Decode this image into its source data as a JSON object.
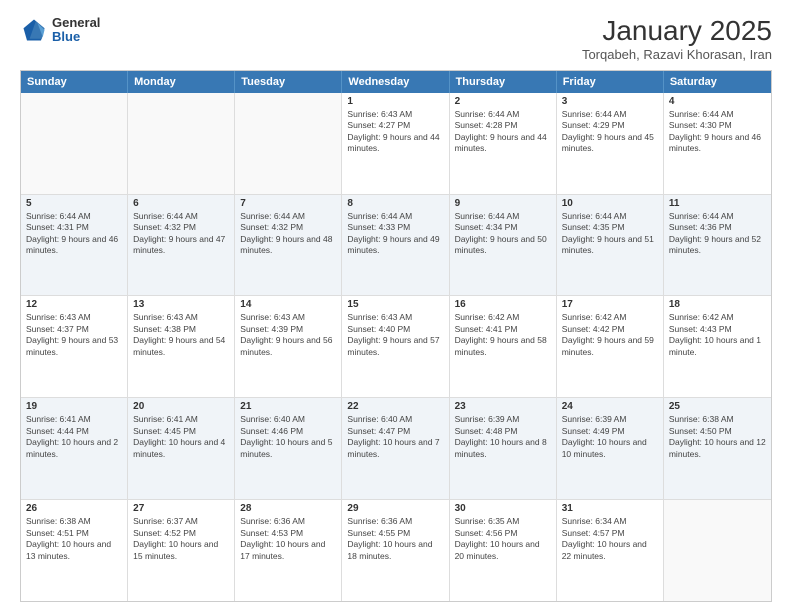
{
  "header": {
    "logo": {
      "general": "General",
      "blue": "Blue"
    },
    "title": "January 2025",
    "subtitle": "Torqabeh, Razavi Khorasan, Iran"
  },
  "calendar": {
    "days": [
      "Sunday",
      "Monday",
      "Tuesday",
      "Wednesday",
      "Thursday",
      "Friday",
      "Saturday"
    ],
    "rows": [
      [
        {
          "day": "",
          "empty": true
        },
        {
          "day": "",
          "empty": true
        },
        {
          "day": "",
          "empty": true
        },
        {
          "day": "1",
          "sunrise": "Sunrise: 6:43 AM",
          "sunset": "Sunset: 4:27 PM",
          "daylight": "Daylight: 9 hours and 44 minutes."
        },
        {
          "day": "2",
          "sunrise": "Sunrise: 6:44 AM",
          "sunset": "Sunset: 4:28 PM",
          "daylight": "Daylight: 9 hours and 44 minutes."
        },
        {
          "day": "3",
          "sunrise": "Sunrise: 6:44 AM",
          "sunset": "Sunset: 4:29 PM",
          "daylight": "Daylight: 9 hours and 45 minutes."
        },
        {
          "day": "4",
          "sunrise": "Sunrise: 6:44 AM",
          "sunset": "Sunset: 4:30 PM",
          "daylight": "Daylight: 9 hours and 46 minutes."
        }
      ],
      [
        {
          "day": "5",
          "sunrise": "Sunrise: 6:44 AM",
          "sunset": "Sunset: 4:31 PM",
          "daylight": "Daylight: 9 hours and 46 minutes."
        },
        {
          "day": "6",
          "sunrise": "Sunrise: 6:44 AM",
          "sunset": "Sunset: 4:32 PM",
          "daylight": "Daylight: 9 hours and 47 minutes."
        },
        {
          "day": "7",
          "sunrise": "Sunrise: 6:44 AM",
          "sunset": "Sunset: 4:32 PM",
          "daylight": "Daylight: 9 hours and 48 minutes."
        },
        {
          "day": "8",
          "sunrise": "Sunrise: 6:44 AM",
          "sunset": "Sunset: 4:33 PM",
          "daylight": "Daylight: 9 hours and 49 minutes."
        },
        {
          "day": "9",
          "sunrise": "Sunrise: 6:44 AM",
          "sunset": "Sunset: 4:34 PM",
          "daylight": "Daylight: 9 hours and 50 minutes."
        },
        {
          "day": "10",
          "sunrise": "Sunrise: 6:44 AM",
          "sunset": "Sunset: 4:35 PM",
          "daylight": "Daylight: 9 hours and 51 minutes."
        },
        {
          "day": "11",
          "sunrise": "Sunrise: 6:44 AM",
          "sunset": "Sunset: 4:36 PM",
          "daylight": "Daylight: 9 hours and 52 minutes."
        }
      ],
      [
        {
          "day": "12",
          "sunrise": "Sunrise: 6:43 AM",
          "sunset": "Sunset: 4:37 PM",
          "daylight": "Daylight: 9 hours and 53 minutes."
        },
        {
          "day": "13",
          "sunrise": "Sunrise: 6:43 AM",
          "sunset": "Sunset: 4:38 PM",
          "daylight": "Daylight: 9 hours and 54 minutes."
        },
        {
          "day": "14",
          "sunrise": "Sunrise: 6:43 AM",
          "sunset": "Sunset: 4:39 PM",
          "daylight": "Daylight: 9 hours and 56 minutes."
        },
        {
          "day": "15",
          "sunrise": "Sunrise: 6:43 AM",
          "sunset": "Sunset: 4:40 PM",
          "daylight": "Daylight: 9 hours and 57 minutes."
        },
        {
          "day": "16",
          "sunrise": "Sunrise: 6:42 AM",
          "sunset": "Sunset: 4:41 PM",
          "daylight": "Daylight: 9 hours and 58 minutes."
        },
        {
          "day": "17",
          "sunrise": "Sunrise: 6:42 AM",
          "sunset": "Sunset: 4:42 PM",
          "daylight": "Daylight: 9 hours and 59 minutes."
        },
        {
          "day": "18",
          "sunrise": "Sunrise: 6:42 AM",
          "sunset": "Sunset: 4:43 PM",
          "daylight": "Daylight: 10 hours and 1 minute."
        }
      ],
      [
        {
          "day": "19",
          "sunrise": "Sunrise: 6:41 AM",
          "sunset": "Sunset: 4:44 PM",
          "daylight": "Daylight: 10 hours and 2 minutes."
        },
        {
          "day": "20",
          "sunrise": "Sunrise: 6:41 AM",
          "sunset": "Sunset: 4:45 PM",
          "daylight": "Daylight: 10 hours and 4 minutes."
        },
        {
          "day": "21",
          "sunrise": "Sunrise: 6:40 AM",
          "sunset": "Sunset: 4:46 PM",
          "daylight": "Daylight: 10 hours and 5 minutes."
        },
        {
          "day": "22",
          "sunrise": "Sunrise: 6:40 AM",
          "sunset": "Sunset: 4:47 PM",
          "daylight": "Daylight: 10 hours and 7 minutes."
        },
        {
          "day": "23",
          "sunrise": "Sunrise: 6:39 AM",
          "sunset": "Sunset: 4:48 PM",
          "daylight": "Daylight: 10 hours and 8 minutes."
        },
        {
          "day": "24",
          "sunrise": "Sunrise: 6:39 AM",
          "sunset": "Sunset: 4:49 PM",
          "daylight": "Daylight: 10 hours and 10 minutes."
        },
        {
          "day": "25",
          "sunrise": "Sunrise: 6:38 AM",
          "sunset": "Sunset: 4:50 PM",
          "daylight": "Daylight: 10 hours and 12 minutes."
        }
      ],
      [
        {
          "day": "26",
          "sunrise": "Sunrise: 6:38 AM",
          "sunset": "Sunset: 4:51 PM",
          "daylight": "Daylight: 10 hours and 13 minutes."
        },
        {
          "day": "27",
          "sunrise": "Sunrise: 6:37 AM",
          "sunset": "Sunset: 4:52 PM",
          "daylight": "Daylight: 10 hours and 15 minutes."
        },
        {
          "day": "28",
          "sunrise": "Sunrise: 6:36 AM",
          "sunset": "Sunset: 4:53 PM",
          "daylight": "Daylight: 10 hours and 17 minutes."
        },
        {
          "day": "29",
          "sunrise": "Sunrise: 6:36 AM",
          "sunset": "Sunset: 4:55 PM",
          "daylight": "Daylight: 10 hours and 18 minutes."
        },
        {
          "day": "30",
          "sunrise": "Sunrise: 6:35 AM",
          "sunset": "Sunset: 4:56 PM",
          "daylight": "Daylight: 10 hours and 20 minutes."
        },
        {
          "day": "31",
          "sunrise": "Sunrise: 6:34 AM",
          "sunset": "Sunset: 4:57 PM",
          "daylight": "Daylight: 10 hours and 22 minutes."
        },
        {
          "day": "",
          "empty": true
        }
      ]
    ]
  }
}
